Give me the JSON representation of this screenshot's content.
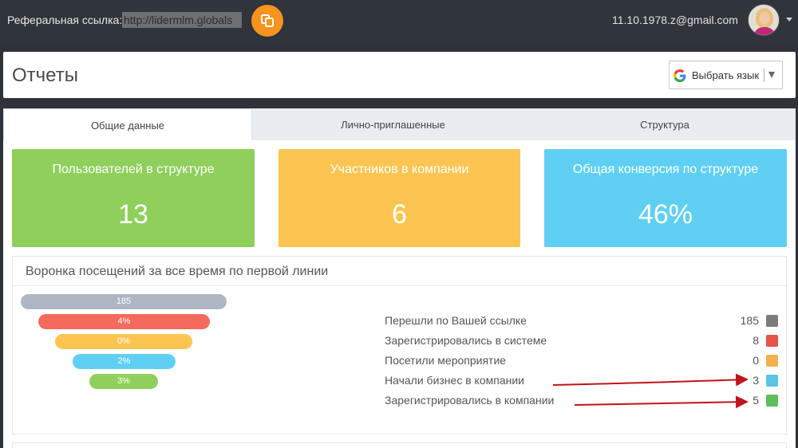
{
  "topbar": {
    "ref_label": "Реферальная ссылка:",
    "ref_value": "http://lidermlm.globals",
    "copy_icon": "copy-icon",
    "email": "11.10.1978.z@gmail.com",
    "avatar_icon": "avatar"
  },
  "header": {
    "title": "Отчеты",
    "lang_label": "Выбрать язык"
  },
  "tabs": [
    {
      "label": "Общие данные",
      "active": true
    },
    {
      "label": "Лично-приглашенные",
      "active": false
    },
    {
      "label": "Структура",
      "active": false
    }
  ],
  "cards": [
    {
      "title": "Пользователей в структуре",
      "value": "13",
      "color": "#8fcf5c"
    },
    {
      "title": "Участников в компании",
      "value": "6",
      "color": "#fcc552"
    },
    {
      "title": "Общая конверсия по структуре",
      "value": "46%",
      "color": "#5fd0f3"
    }
  ],
  "funnel": {
    "title": "Воронка посещений за все время по первой линии",
    "bars": [
      {
        "label": "185",
        "color": "#aeb6c6"
      },
      {
        "label": "4%",
        "color": "#f46a5c"
      },
      {
        "label": "0%",
        "color": "#fcc552"
      },
      {
        "label": "2%",
        "color": "#5fd0f3"
      },
      {
        "label": "3%",
        "color": "#8fcf5c"
      }
    ],
    "legend": [
      {
        "label": "Перешли по Вашей ссылке",
        "value": "185",
        "color": "#7b7b7b"
      },
      {
        "label": "Зарегистрировались в системе",
        "value": "8",
        "color": "#e2554b"
      },
      {
        "label": "Посетили мероприятие",
        "value": "0",
        "color": "#f2b050"
      },
      {
        "label": "Начали бизнес в компании",
        "value": "3",
        "color": "#5bc3e5"
      },
      {
        "label": "Зарегистрировались в компании",
        "value": "5",
        "color": "#5cbf5c"
      }
    ]
  }
}
